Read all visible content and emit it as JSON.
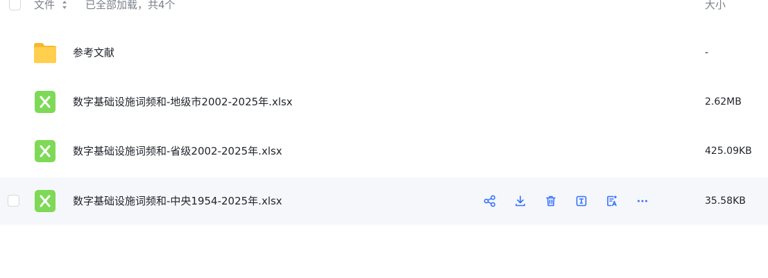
{
  "header": {
    "name_label": "文件",
    "count_label": "已全部加载，共4个",
    "size_label": "大小"
  },
  "files": [
    {
      "name": "参考文献",
      "size": "-",
      "type": "folder"
    },
    {
      "name": "数字基础设施词频和-地级市2002-2025年.xlsx",
      "size": "2.62MB",
      "type": "xlsx"
    },
    {
      "name": "数字基础设施词频和-省级2002-2025年.xlsx",
      "size": "425.09KB",
      "type": "xlsx"
    },
    {
      "name": "数字基础设施词频和-中央1954-2025年.xlsx",
      "size": "35.58KB",
      "type": "xlsx"
    }
  ],
  "row_actions": [
    "share-icon",
    "download-icon",
    "delete-icon",
    "rename-icon",
    "ai-icon",
    "more-icon"
  ],
  "colors": {
    "accent": "#3370ff",
    "folder": "#ffc53d",
    "excel": "#73d13d",
    "hover_row": "#f5f7fa",
    "muted_text": "#7b8089"
  }
}
